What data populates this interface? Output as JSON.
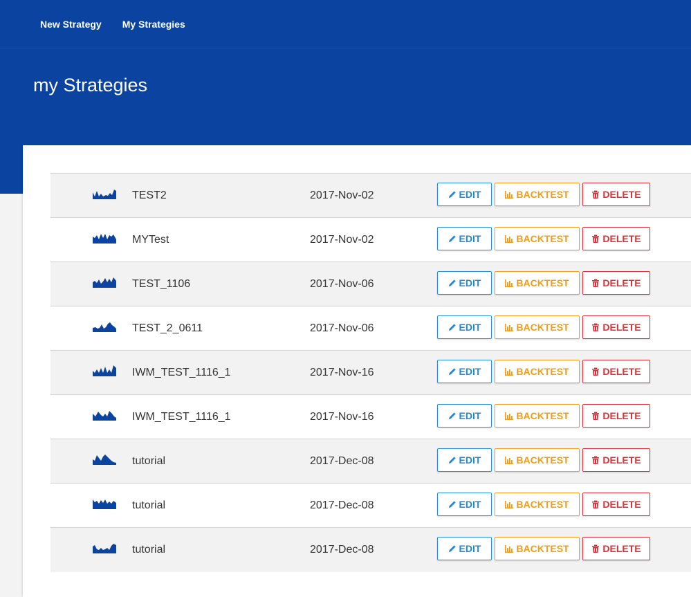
{
  "nav": {
    "new_strategy": "New Strategy",
    "my_strategies": "My Strategies"
  },
  "page": {
    "title": "my Strategies"
  },
  "actions": {
    "edit": "EDIT",
    "backtest": "BACKTEST",
    "delete": "DELETE"
  },
  "colors": {
    "brand": "#0b44a0",
    "edit": "#1f88d2",
    "backtest": "#f39c12",
    "delete": "#d63238"
  },
  "strategies": [
    {
      "name": "TEST2",
      "date": "2017-Nov-02"
    },
    {
      "name": "MYTest",
      "date": "2017-Nov-02"
    },
    {
      "name": "TEST_1106",
      "date": "2017-Nov-06"
    },
    {
      "name": "TEST_2_0611",
      "date": "2017-Nov-06"
    },
    {
      "name": "IWM_TEST_1116_1",
      "date": "2017-Nov-16"
    },
    {
      "name": "IWM_TEST_1116_1",
      "date": "2017-Nov-16"
    },
    {
      "name": "tutorial",
      "date": "2017-Dec-08"
    },
    {
      "name": "tutorial",
      "date": "2017-Dec-08"
    },
    {
      "name": "tutorial",
      "date": "2017-Dec-08"
    }
  ]
}
